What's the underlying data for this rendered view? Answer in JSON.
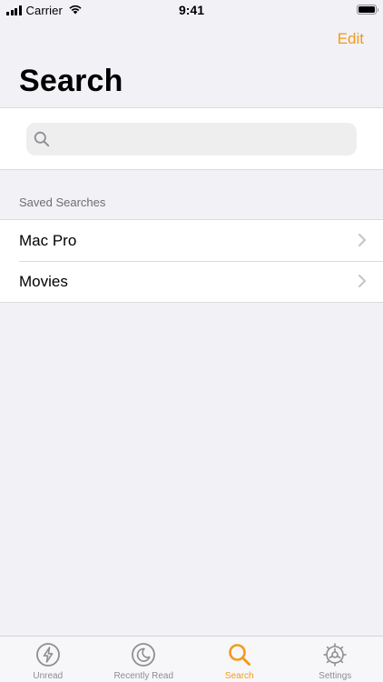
{
  "status_bar": {
    "carrier": "Carrier",
    "time": "9:41"
  },
  "nav": {
    "edit_label": "Edit",
    "title": "Search"
  },
  "search": {
    "placeholder": "",
    "value": ""
  },
  "saved_searches": {
    "header": "Saved Searches",
    "items": [
      {
        "label": "Mac Pro"
      },
      {
        "label": "Movies"
      }
    ]
  },
  "tab_bar": {
    "tabs": [
      {
        "label": "Unread",
        "icon": "lightning-icon",
        "active": false
      },
      {
        "label": "Recently Read",
        "icon": "moon-icon",
        "active": false
      },
      {
        "label": "Search",
        "icon": "search-icon",
        "active": true
      },
      {
        "label": "Settings",
        "icon": "gear-icon",
        "active": false
      }
    ]
  },
  "colors": {
    "accent": "#f19a1e",
    "background": "#f2f1f6",
    "inactive_tab": "#8e8e93"
  }
}
